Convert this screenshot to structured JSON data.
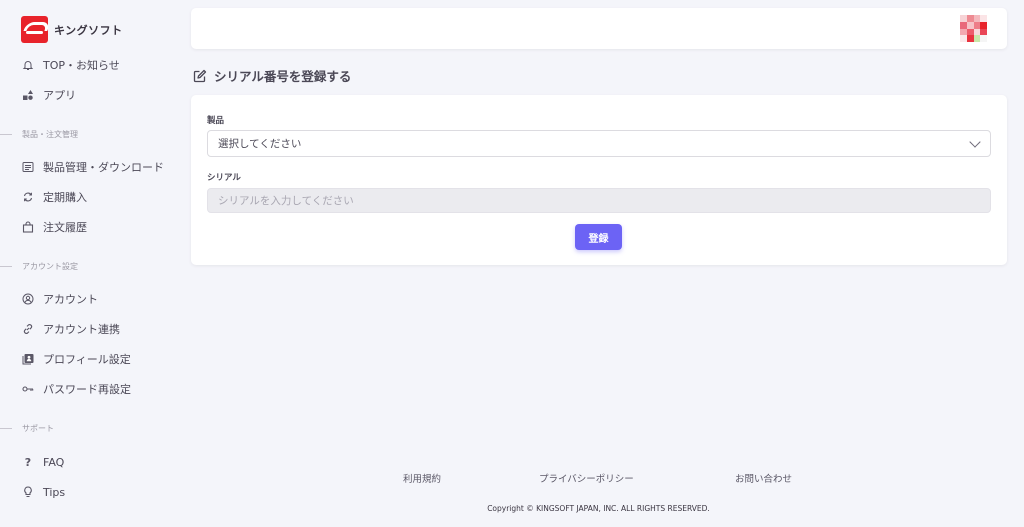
{
  "brand": {
    "name": "キングソフト",
    "color": "#e8232b"
  },
  "sidebar": {
    "top_items": [
      {
        "label": "TOP・お知らせ",
        "icon": "bell-icon"
      },
      {
        "label": "アプリ",
        "icon": "shapes-icon"
      }
    ],
    "sections": [
      {
        "title": "製品・注文管理",
        "items": [
          {
            "label": "製品管理・ダウンロード",
            "icon": "list-icon"
          },
          {
            "label": "定期購入",
            "icon": "refresh-icon"
          },
          {
            "label": "注文履歴",
            "icon": "bag-icon"
          }
        ]
      },
      {
        "title": "アカウント設定",
        "items": [
          {
            "label": "アカウント",
            "icon": "user-circle-icon"
          },
          {
            "label": "アカウント連携",
            "icon": "link-icon"
          },
          {
            "label": "プロフィール設定",
            "icon": "profile-card-icon"
          },
          {
            "label": "パスワード再設定",
            "icon": "key-icon"
          }
        ]
      },
      {
        "title": "サポート",
        "items": [
          {
            "label": "FAQ",
            "icon": "question-icon"
          },
          {
            "label": "Tips",
            "icon": "lightbulb-icon"
          }
        ]
      }
    ]
  },
  "page": {
    "title": "シリアル番号を登録する",
    "title_icon": "edit-icon"
  },
  "form": {
    "product_label": "製品",
    "product_value": "選択してください",
    "serial_label": "シリアル",
    "serial_placeholder": "シリアルを入力してください",
    "submit_label": "登録",
    "accent_color": "#6c63f5"
  },
  "footer": {
    "links": [
      "利用規約",
      "プライバシーポリシー",
      "お問い合わせ"
    ],
    "copyright": "Copyright © KINGSOFT JAPAN, INC. ALL RIGHTS RESERVED."
  }
}
